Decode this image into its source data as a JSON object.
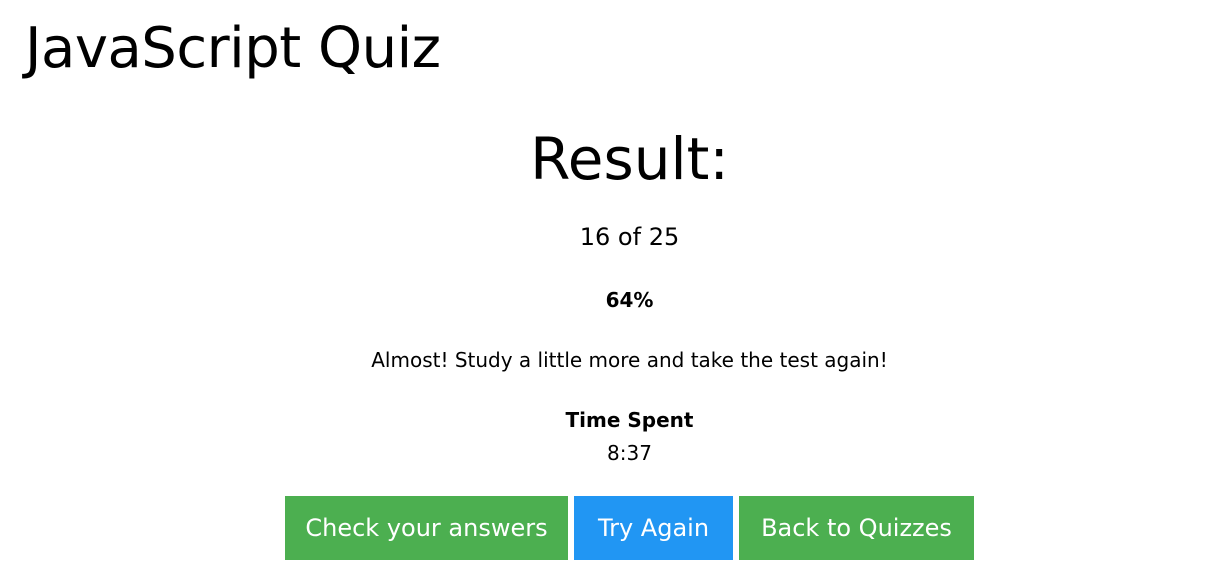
{
  "header": {
    "title": "JavaScript Quiz"
  },
  "result": {
    "heading": "Result:",
    "score": "16 of 25",
    "percent": "64%",
    "feedback": "Almost! Study a little more and take the test again!",
    "time_label": "Time Spent",
    "time_value": "8:37"
  },
  "actions": {
    "check_label": "Check your answers",
    "try_label": "Try Again",
    "back_label": "Back to Quizzes"
  },
  "colors": {
    "primary_green": "#4caf50",
    "primary_blue": "#2196f3"
  }
}
